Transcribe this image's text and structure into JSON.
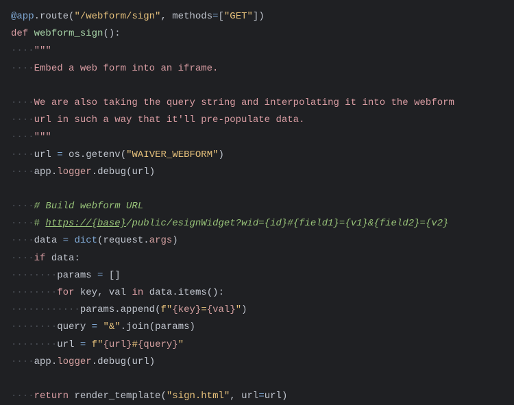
{
  "lines": {
    "l1": {
      "decorator": "@app",
      "dot": ".",
      "method": "route",
      "open": "(",
      "string": "\"/webform/sign\"",
      "comma": ", ",
      "kwarg": "methods",
      "eq": "=",
      "lb": "[",
      "strget": "\"GET\"",
      "rb": "]",
      "close": ")"
    },
    "l2": {
      "def": "def",
      "space": " ",
      "name": "webform_sign",
      "parens": "()",
      "colon": ":"
    },
    "l3": {
      "indent": "····",
      "quotes": "\"\"\""
    },
    "l4": {
      "indent": "····",
      "text": "Embed a web form into an iframe."
    },
    "l5": {
      "indent": "····",
      "text": "We are also taking the query string and interpolating it into the webform"
    },
    "l6": {
      "indent": "····",
      "text": "url in such a way that it'll pre-populate data."
    },
    "l7": {
      "indent": "····",
      "quotes": "\"\"\""
    },
    "l8": {
      "indent": "····",
      "var": "url",
      "eq": " = ",
      "obj": "os",
      "dot": ".",
      "method": "getenv",
      "open": "(",
      "string": "\"WAIVER_WEBFORM\"",
      "close": ")"
    },
    "l9": {
      "indent": "····",
      "obj": "app",
      "dot1": ".",
      "prop": "logger",
      "dot2": ".",
      "method": "debug",
      "open": "(",
      "arg": "url",
      "close": ")"
    },
    "l10": {
      "indent": "····",
      "comment": "# Build webform URL"
    },
    "l11": {
      "indent": "····",
      "hash": "# ",
      "url": "https://{base}",
      "rest": "/public/esignWidget?wid={id}#{field1}={v1}&{field2}={v2}"
    },
    "l12": {
      "indent": "····",
      "var": "data",
      "eq": " = ",
      "func": "dict",
      "open": "(",
      "obj": "request",
      "dot": ".",
      "prop": "args",
      "close": ")"
    },
    "l13": {
      "indent": "····",
      "kw": "if",
      "space": " ",
      "var": "data",
      "colon": ":"
    },
    "l14": {
      "indent": "········",
      "var": "params",
      "eq": " = ",
      "brackets": "[]"
    },
    "l15": {
      "indent": "········",
      "for": "for",
      "sp1": " ",
      "key": "key",
      "comma": ", ",
      "val": "val",
      "sp2": " ",
      "in": "in",
      "sp3": " ",
      "obj": "data",
      "dot": ".",
      "method": "items",
      "parens": "()",
      "colon": ":"
    },
    "l16": {
      "indent": "············",
      "obj": "params",
      "dot": ".",
      "method": "append",
      "open": "(",
      "f": "f",
      "q1": "\"",
      "b1": "{key}",
      "mid": "=",
      "b2": "{val}",
      "q2": "\"",
      "close": ")"
    },
    "l17": {
      "indent": "········",
      "var": "query",
      "eq": " = ",
      "str": "\"&\"",
      "dot": ".",
      "method": "join",
      "open": "(",
      "arg": "params",
      "close": ")"
    },
    "l18": {
      "indent": "········",
      "var": "url",
      "eq": " = ",
      "f": "f",
      "q1": "\"",
      "b1": "{url}",
      "hash": "#",
      "b2": "{query}",
      "q2": "\""
    },
    "l19": {
      "indent": "····",
      "obj": "app",
      "dot1": ".",
      "prop": "logger",
      "dot2": ".",
      "method": "debug",
      "open": "(",
      "arg": "url",
      "close": ")"
    },
    "l20": {
      "indent": "····",
      "kw": "return",
      "sp": " ",
      "func": "render_template",
      "open": "(",
      "str": "\"sign.html\"",
      "comma": ", ",
      "kwarg": "url",
      "eq": "=",
      "val": "url",
      "close": ")"
    }
  }
}
